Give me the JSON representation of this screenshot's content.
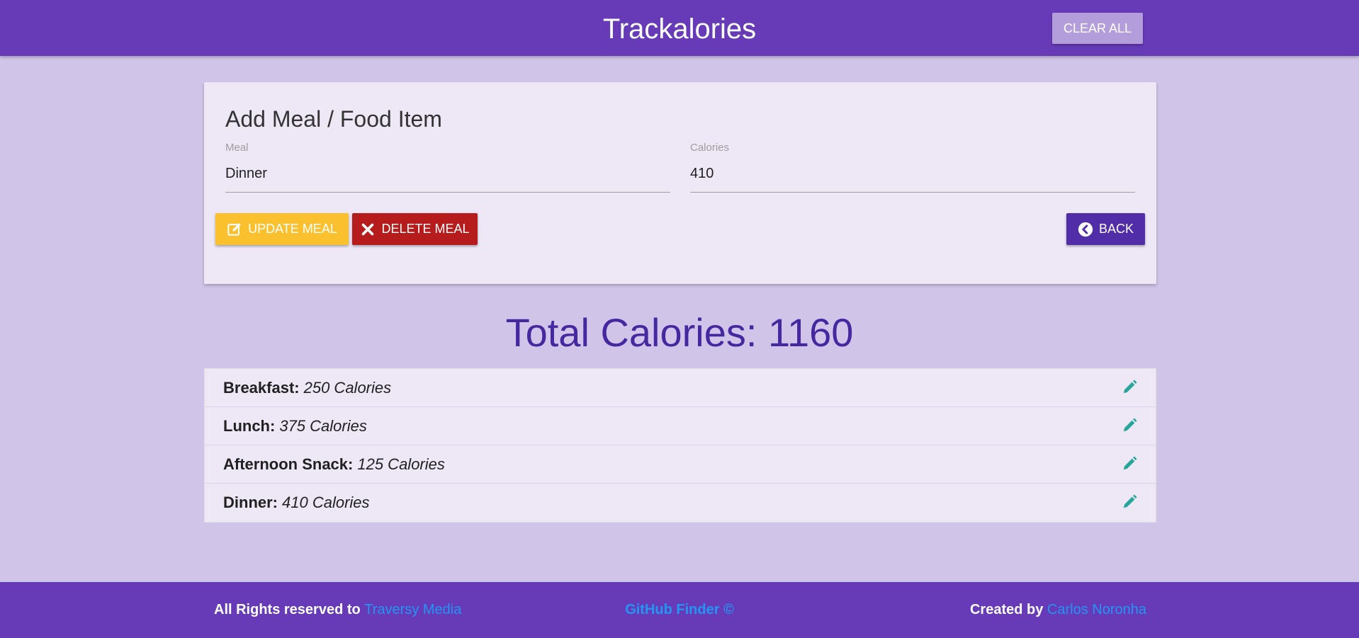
{
  "app": {
    "title": "Trackalories",
    "clear_all_label": "CLEAR ALL"
  },
  "form": {
    "title": "Add Meal / Food Item",
    "meal_label": "Meal",
    "meal_value": "Dinner",
    "calories_label": "Calories",
    "calories_value": "410",
    "update_label": "UPDATE MEAL",
    "delete_label": "DELETE MEAL",
    "back_label": "BACK"
  },
  "total": {
    "label": "Total Calories: 1160"
  },
  "meals": [
    {
      "name": "Breakfast:",
      "calories": "250 Calories"
    },
    {
      "name": "Lunch:",
      "calories": "375 Calories"
    },
    {
      "name": "Afternoon Snack:",
      "calories": "125 Calories"
    },
    {
      "name": "Dinner:",
      "calories": "410 Calories"
    }
  ],
  "footer": {
    "left_text": "All Rights reserved to",
    "left_link": "Traversy Media",
    "middle_link": "GitHub Finder ©",
    "right_text": "Created by",
    "right_link": "Carlos Noronha"
  },
  "colors": {
    "primary": "#673ab7",
    "background": "#d1c4e9",
    "card": "#ede7f6",
    "update": "#fbc02d",
    "delete": "#b71c1c",
    "back": "#512da8",
    "edit_icon": "#26a69a",
    "link": "#2196f3"
  },
  "icons": {
    "update": "pencil-square-icon",
    "delete": "times-icon",
    "back": "chevron-circle-left-icon",
    "edit": "pencil-icon"
  }
}
